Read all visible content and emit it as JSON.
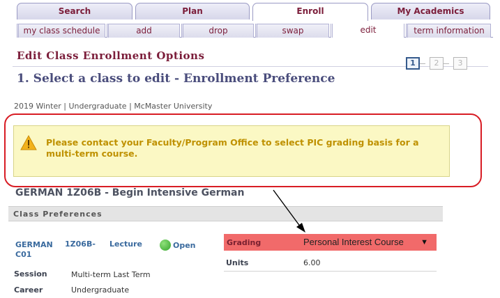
{
  "main_tabs": [
    {
      "label": "Search",
      "active": false
    },
    {
      "label": "Plan",
      "active": false
    },
    {
      "label": "Enroll",
      "active": true
    },
    {
      "label": "My Academics",
      "active": false
    }
  ],
  "sub_tabs": [
    {
      "label": "my class schedule",
      "active": false
    },
    {
      "label": "add",
      "active": false
    },
    {
      "label": "drop",
      "active": false
    },
    {
      "label": "swap",
      "active": false
    },
    {
      "label": "edit",
      "active": true
    },
    {
      "label": "term information",
      "active": false
    }
  ],
  "page_header": "Edit Class Enrollment Options",
  "steps": {
    "labels": [
      "1",
      "2",
      "3"
    ],
    "current": 1
  },
  "step_title": "1.  Select a class to edit - Enrollment Preference",
  "term_info": "2019 Winter | Undergraduate | McMaster University",
  "warning": {
    "icon": "warning-triangle-icon",
    "text": "Please contact your Faculty/Program Office to select PIC grading basis for a multi-term course."
  },
  "class_title": "GERMAN    1Z06B - Begin Intensive German",
  "section_label": "Class Preferences",
  "class_info": {
    "subject": "GERMAN",
    "section": "C01",
    "catalog": "1Z06B-",
    "component": "Lecture",
    "status": "Open"
  },
  "session": {
    "label": "Session",
    "value": "Multi-term Last Term"
  },
  "career": {
    "label": "Career",
    "value": "Undergraduate"
  },
  "grading": {
    "label": "Grading",
    "selected": "Personal Interest Course"
  },
  "units": {
    "label": "Units",
    "value": "6.00"
  },
  "colors": {
    "tab_text": "#7b1d3a",
    "grading_highlight": "#f16a6a",
    "warning_bg": "#fbf8c4",
    "warning_text": "#bf9100",
    "annotation_ring": "#d81c24"
  }
}
